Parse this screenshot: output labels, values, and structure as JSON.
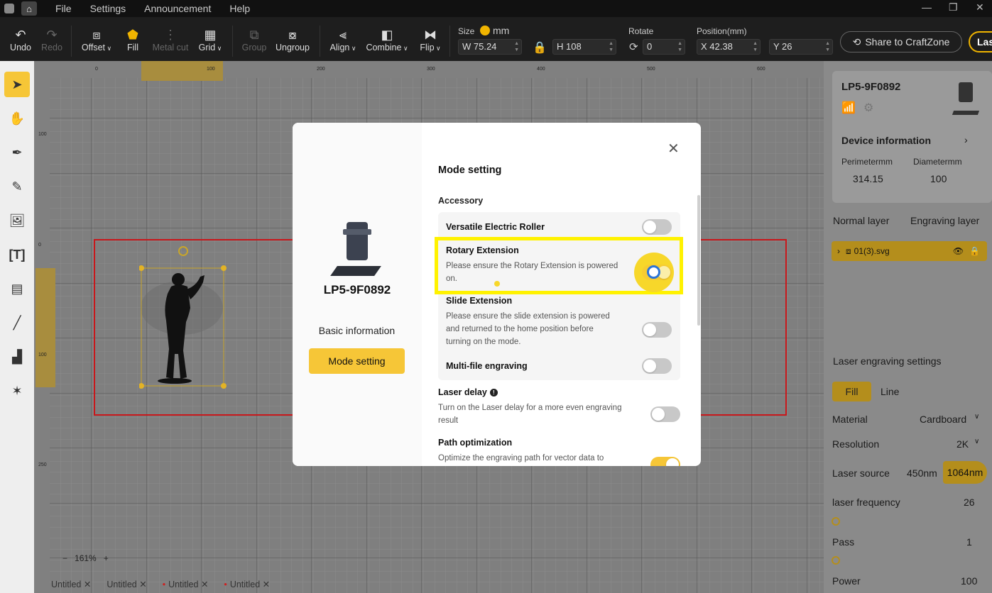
{
  "menubar": {
    "items": [
      "File",
      "Settings",
      "Announcement",
      "Help"
    ],
    "window_controls": [
      "—",
      "❐",
      "✕"
    ]
  },
  "toolbar": {
    "undo": "Undo",
    "redo": "Redo",
    "offset": "Offset",
    "fill": "Fill",
    "metal_cut": "Metal cut",
    "grid": "Grid",
    "group": "Group",
    "ungroup": "Ungroup",
    "align": "Align",
    "combine": "Combine",
    "flip": "Flip",
    "size_label": "Size",
    "size_unit": "mm",
    "width_value": "W 75.24",
    "height_value": "H 108",
    "rotate_label": "Rotate",
    "rotate_value": "0",
    "position_label": "Position(mm)",
    "x_value": "X 42.38",
    "y_value": "Y 26",
    "share_label": "Share to CraftZone",
    "las_label": "Las"
  },
  "left_tools": [
    "select-icon",
    "hand-icon",
    "pen-icon",
    "pencil-icon",
    "image-add-icon",
    "text-icon",
    "barcode-icon",
    "line-icon",
    "stamp-icon",
    "magic-icon"
  ],
  "canvas": {
    "ruler_top": [
      "0",
      "100",
      "200",
      "300",
      "400",
      "500",
      "600"
    ],
    "ruler_left": [
      "100",
      "0",
      "100",
      "250"
    ],
    "zoom_minus": "−",
    "zoom_value": "161%",
    "zoom_plus": "+"
  },
  "file_tabs": [
    {
      "name": "Untitled",
      "dirty": false
    },
    {
      "name": "Untitled",
      "dirty": true
    },
    {
      "name": "Untitled",
      "dirty": true
    },
    {
      "name": "Untitled",
      "dirty": true
    }
  ],
  "right_panel": {
    "device_name": "LP5-9F0892",
    "device_info_label": "Device information",
    "perimeter_label": "Perimetermm",
    "perimeter_value": "314.15",
    "diameter_label": "Diametermm",
    "diameter_value": "100",
    "tab_normal": "Normal layer",
    "tab_engraving": "Engraving layer",
    "layer_file": "01(3).svg",
    "laser_settings_label": "Laser engraving settings",
    "seg_fill": "Fill",
    "seg_line": "Line",
    "material_label": "Material",
    "material_value": "Cardboard",
    "resolution_label": "Resolution",
    "resolution_value": "2K",
    "laser_source_label": "Laser source",
    "laser_450": "450nm",
    "laser_1064": "1064nm",
    "laser_freq_label": "laser frequency",
    "laser_freq_value": "26",
    "pass_label": "Pass",
    "pass_value": "1",
    "power_label": "Power",
    "power_value": "100"
  },
  "modal": {
    "device_name": "LP5-9F0892",
    "menu_basic": "Basic information",
    "menu_mode": "Mode setting",
    "title": "Mode setting",
    "accessory_label": "Accessory",
    "roller_title": "Versatile Electric Roller",
    "rotary_title": "Rotary Extension",
    "rotary_desc_line1": "Please ensure the Rotary Extension is powered",
    "rotary_desc_line2": "on.",
    "slide_title": "Slide Extension",
    "slide_desc_line1": "Please ensure the slide extension is powered",
    "slide_desc_line2": "and returned to the home position before",
    "slide_desc_line3": "turning on the mode.",
    "multifile_title": "Multi-file engraving",
    "laser_delay_title": "Laser delay",
    "laser_delay_desc_line1": "Turn on the Laser delay for a more even engraving",
    "laser_delay_desc_line2": "result",
    "path_opt_title": "Path optimization",
    "path_opt_desc_line1": "Optimize the engraving path for vector data to",
    "toggles": {
      "roller": false,
      "rotary": true,
      "slide": false,
      "multifile": false,
      "laser_delay": false,
      "path_opt": true
    }
  },
  "colors": {
    "accent": "#f6c637",
    "highlight": "#fff200",
    "canvas": "#7f7f7f",
    "work_area_border": "#c8171b"
  }
}
